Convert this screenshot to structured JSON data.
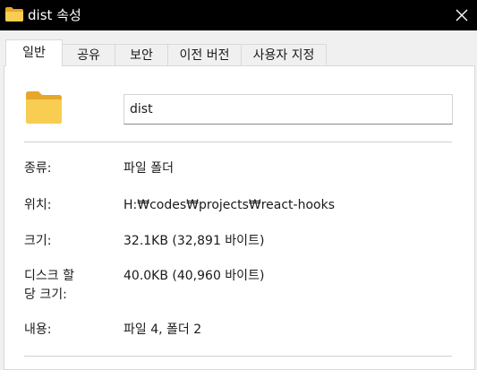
{
  "window": {
    "title": "dist 속성",
    "title_icon": "folder-icon",
    "close_icon": "close-icon"
  },
  "tabs": [
    {
      "label": "일반",
      "active": true
    },
    {
      "label": "공유",
      "active": false
    },
    {
      "label": "보안",
      "active": false
    },
    {
      "label": "이전 버전",
      "active": false
    },
    {
      "label": "사용자 지정",
      "active": false
    }
  ],
  "general": {
    "folder_icon": "folder-icon",
    "name_value": "dist",
    "rows": [
      {
        "label": "종류:",
        "value": "파일 폴더"
      },
      {
        "label": "위치:",
        "value": "H:₩codes₩projects₩react-hooks"
      },
      {
        "label": "크기:",
        "value": "32.1KB (32,891 바이트)"
      },
      {
        "label": "디스크 할",
        "label2": "당 크기:",
        "value": "40.0KB (40,960 바이트)"
      },
      {
        "label": "내용:",
        "value": "파일 4, 폴더 2"
      }
    ]
  },
  "colors": {
    "titlebar_bg": "#000000",
    "folder_yellow": "#f8cd52",
    "folder_tab": "#e6a82a"
  }
}
